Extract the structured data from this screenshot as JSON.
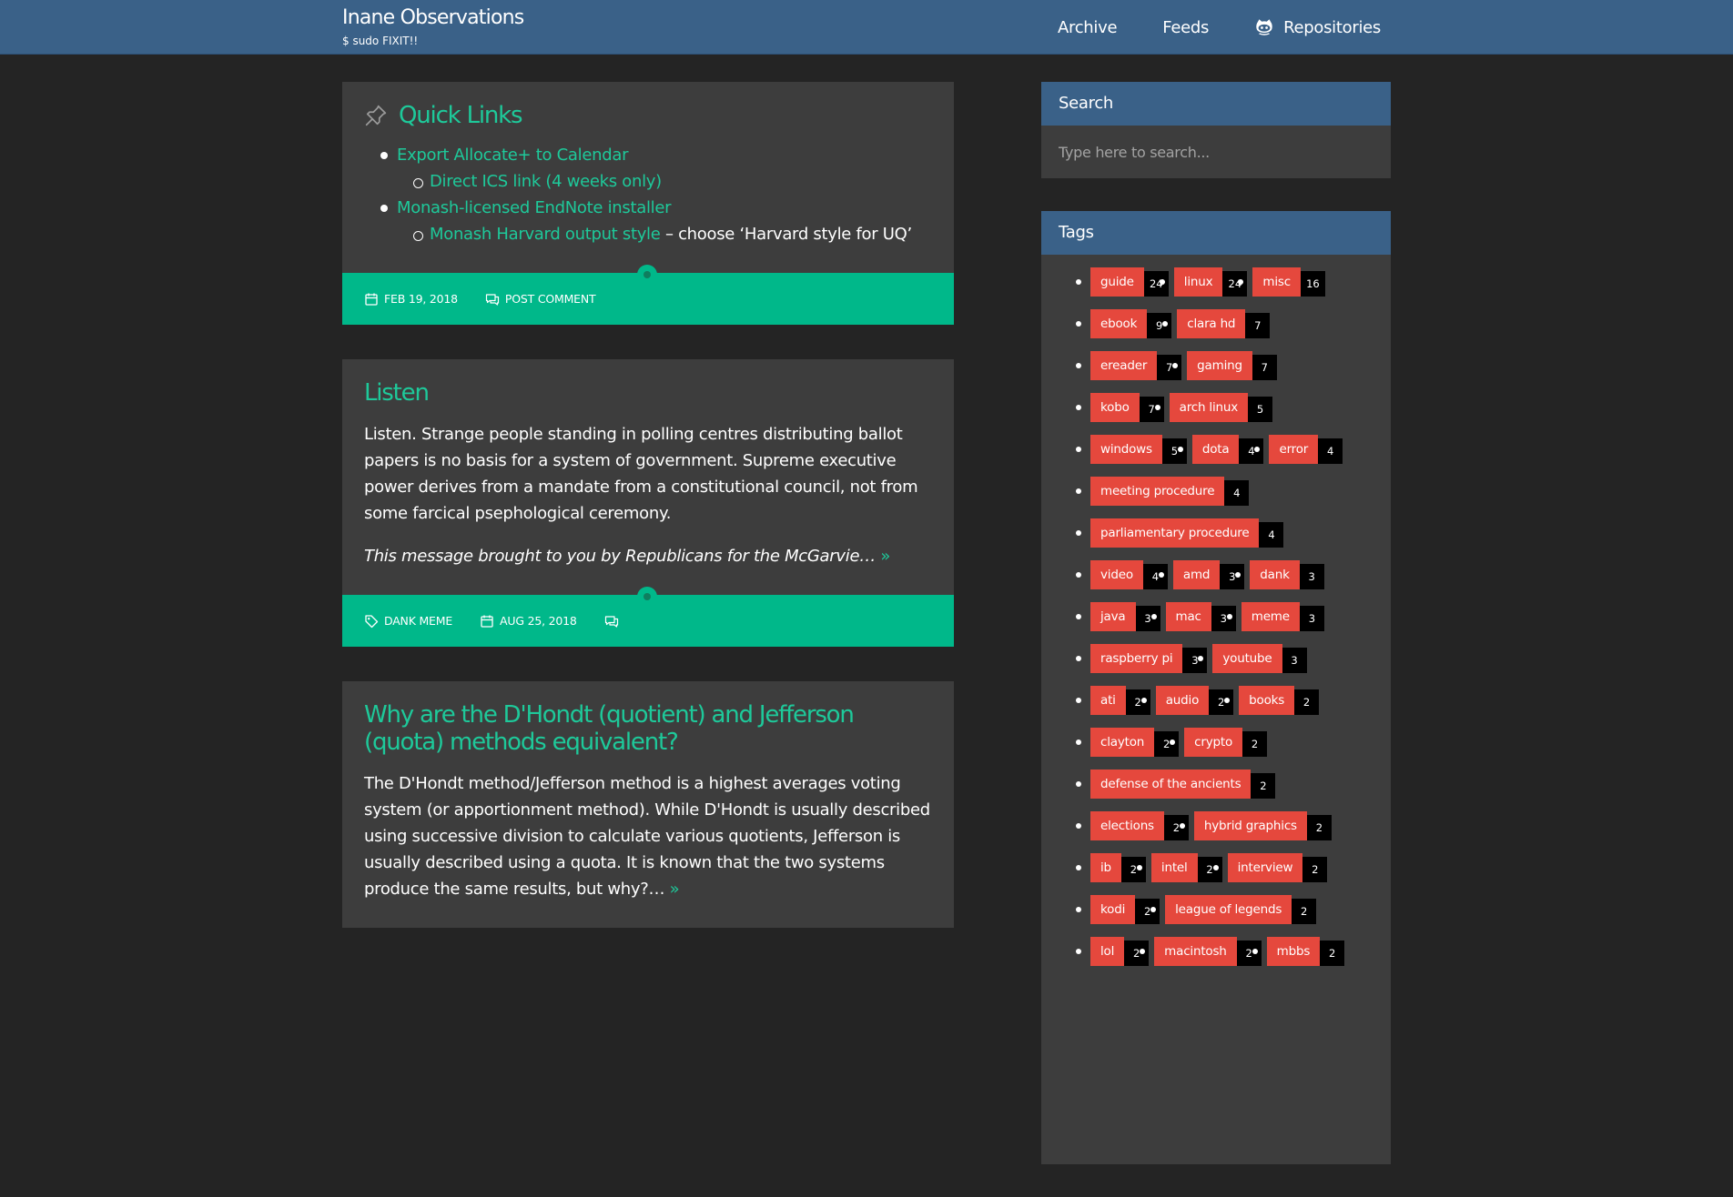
{
  "header": {
    "site_title": "Inane Observations",
    "site_description": "$ sudo FIXIT!!",
    "nav": {
      "archive": "Archive",
      "feeds": "Feeds",
      "repositories": "Repositories"
    },
    "repositories_icon": "github-octocat-icon"
  },
  "posts": [
    {
      "title": "Quick Links",
      "title_icon": "pin-icon",
      "links": [
        {
          "text": "Export Allocate+ to Calendar",
          "sub": [
            {
              "text": "Direct ICS link (4 weeks only)",
              "suffix": ""
            }
          ]
        },
        {
          "text": "Monash-licensed EndNote installer",
          "sub": [
            {
              "text": "Monash Harvard output style",
              "suffix": " – choose ‘Harvard style for UQ’"
            }
          ]
        }
      ],
      "footer": {
        "date": "FEB 19, 2018",
        "comment": "POST COMMENT"
      }
    },
    {
      "title": "Listen",
      "paragraph": "Listen. Strange people standing in polling centres distributing ballot papers is no basis for a system of government. Supreme executive power derives from a mandate from a constitutional council, not from some farcical psephological ceremony.",
      "italic": "This message brought to you by Republicans for the McGarvie…",
      "more": "»",
      "footer": {
        "tag": "DANK MEME",
        "date": "AUG 25, 2018",
        "comment": ""
      }
    },
    {
      "title": "Why are the D'Hondt (quotient) and Jefferson (quota) methods equivalent?",
      "paragraph": "The D'Hondt method/Jefferson method is a highest averages voting system (or apportionment method). While D'Hondt is usually described using successive division to calculate various quotients, Jefferson is usually described using a quota. It is known that the two systems produce the same results, but why?…",
      "more": "»"
    }
  ],
  "sidebar": {
    "search": {
      "title": "Search",
      "placeholder": "Type here to search..."
    },
    "tags": {
      "title": "Tags",
      "rows": [
        [
          {
            "name": "guide",
            "count": "24"
          },
          {
            "name": "linux",
            "count": "24"
          },
          {
            "name": "misc",
            "count": "16"
          }
        ],
        [
          {
            "name": "ebook",
            "count": "9"
          },
          {
            "name": "clara hd",
            "count": "7"
          }
        ],
        [
          {
            "name": "ereader",
            "count": "7"
          },
          {
            "name": "gaming",
            "count": "7"
          }
        ],
        [
          {
            "name": "kobo",
            "count": "7"
          },
          {
            "name": "arch linux",
            "count": "5"
          }
        ],
        [
          {
            "name": "windows",
            "count": "5"
          },
          {
            "name": "dota",
            "count": "4"
          },
          {
            "name": "error",
            "count": "4"
          }
        ],
        [
          {
            "name": "meeting procedure",
            "count": "4"
          }
        ],
        [
          {
            "name": "parliamentary procedure",
            "count": "4"
          }
        ],
        [
          {
            "name": "video",
            "count": "4"
          },
          {
            "name": "amd",
            "count": "3"
          },
          {
            "name": "dank",
            "count": "3"
          }
        ],
        [
          {
            "name": "java",
            "count": "3"
          },
          {
            "name": "mac",
            "count": "3"
          },
          {
            "name": "meme",
            "count": "3"
          }
        ],
        [
          {
            "name": "raspberry pi",
            "count": "3"
          },
          {
            "name": "youtube",
            "count": "3"
          }
        ],
        [
          {
            "name": "ati",
            "count": "2"
          },
          {
            "name": "audio",
            "count": "2"
          },
          {
            "name": "books",
            "count": "2"
          }
        ],
        [
          {
            "name": "clayton",
            "count": "2"
          },
          {
            "name": "crypto",
            "count": "2"
          }
        ],
        [
          {
            "name": "defense of the ancients",
            "count": "2"
          }
        ],
        [
          {
            "name": "elections",
            "count": "2"
          },
          {
            "name": "hybrid graphics",
            "count": "2"
          }
        ],
        [
          {
            "name": "ib",
            "count": "2"
          },
          {
            "name": "intel",
            "count": "2"
          },
          {
            "name": "interview",
            "count": "2"
          }
        ],
        [
          {
            "name": "kodi",
            "count": "2"
          },
          {
            "name": "league of legends",
            "count": "2"
          }
        ],
        [
          {
            "name": "lol",
            "count": "2"
          },
          {
            "name": "macintosh",
            "count": "2"
          },
          {
            "name": "mbbs",
            "count": "2"
          }
        ]
      ]
    }
  },
  "colors": {
    "header_bg": "#3a6188",
    "page_bg": "#242424",
    "card_bg": "#3d3d3d",
    "accent_green": "#1ec99a",
    "footer_green": "#00b88a",
    "tag_red": "#e5483d",
    "tag_count_bg": "#000000"
  }
}
